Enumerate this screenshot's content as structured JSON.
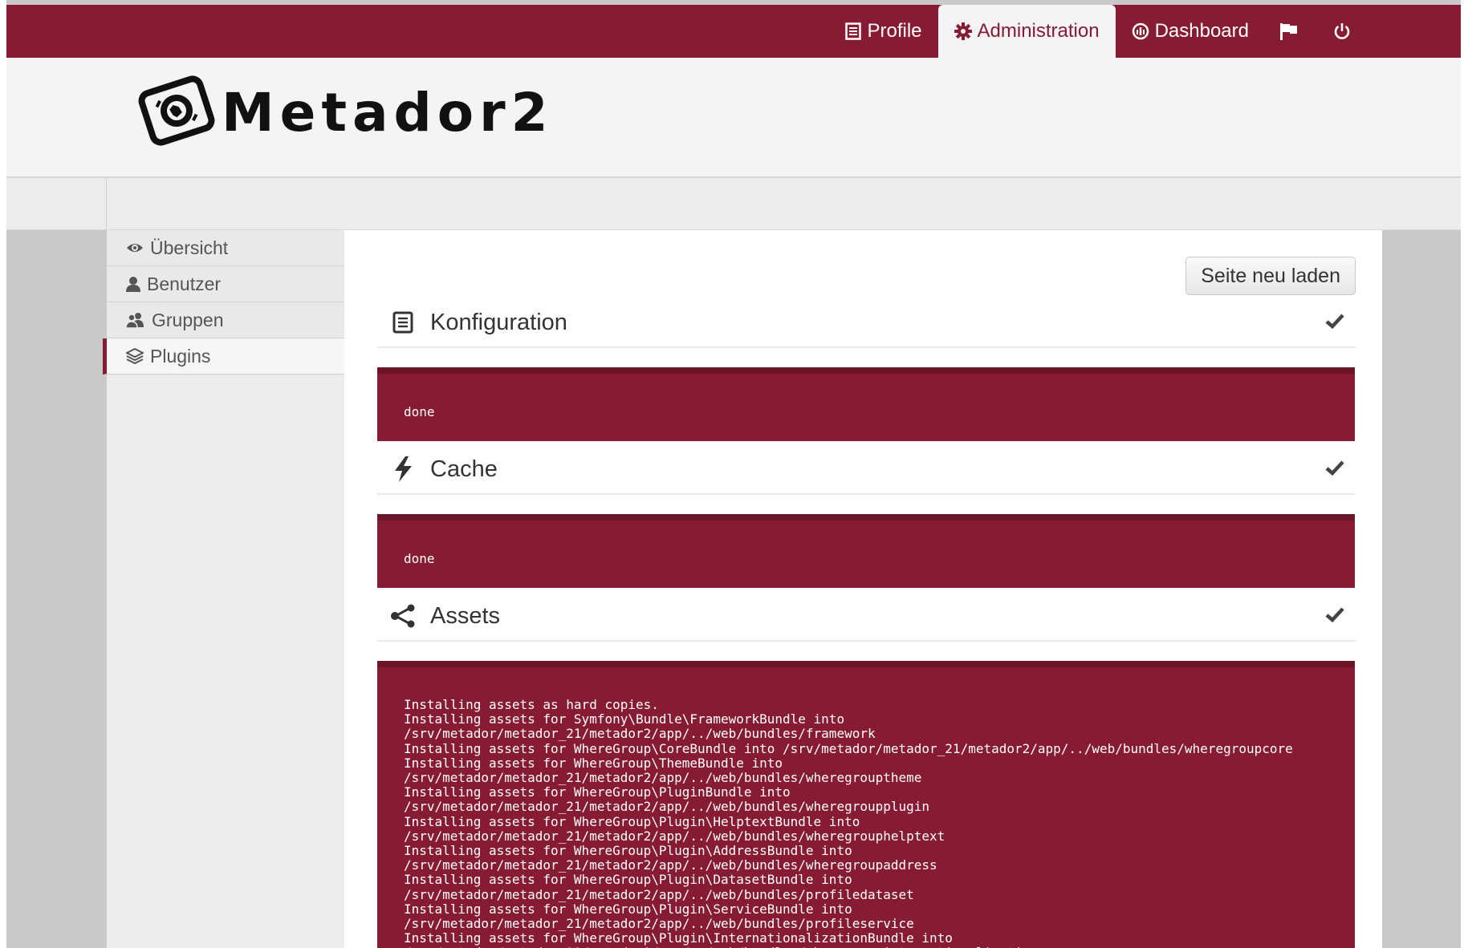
{
  "topnav": {
    "profile": "Profile",
    "administration": "Administration",
    "dashboard": "Dashboard",
    "flag_icon": "flag-icon",
    "power_icon": "power-icon"
  },
  "brand": {
    "name": "Metador2"
  },
  "sidebar": {
    "items": [
      {
        "label": "Übersicht",
        "icon": "eye-icon"
      },
      {
        "label": "Benutzer",
        "icon": "user-icon"
      },
      {
        "label": "Gruppen",
        "icon": "group-icon"
      },
      {
        "label": "Plugins",
        "icon": "layers-icon",
        "active": true
      }
    ]
  },
  "main": {
    "reload_label": "Seite neu laden",
    "sections": [
      {
        "title": "Konfiguration",
        "icon": "document-icon",
        "status": "check-icon",
        "output": "done"
      },
      {
        "title": "Cache",
        "icon": "bolt-icon",
        "status": "check-icon",
        "output": "done"
      },
      {
        "title": "Assets",
        "icon": "share-icon",
        "status": "check-icon",
        "output": "Installing assets as hard copies.\nInstalling assets for Symfony\\Bundle\\FrameworkBundle into\n/srv/metador/metador_21/metador2/app/../web/bundles/framework\nInstalling assets for WhereGroup\\CoreBundle into /srv/metador/metador_21/metador2/app/../web/bundles/wheregroupcore\nInstalling assets for WhereGroup\\ThemeBundle into\n/srv/metador/metador_21/metador2/app/../web/bundles/wheregrouptheme\nInstalling assets for WhereGroup\\PluginBundle into\n/srv/metador/metador_21/metador2/app/../web/bundles/wheregroupplugin\nInstalling assets for WhereGroup\\Plugin\\HelptextBundle into\n/srv/metador/metador_21/metador2/app/../web/bundles/wheregrouphelptext\nInstalling assets for WhereGroup\\Plugin\\AddressBundle into\n/srv/metador/metador_21/metador2/app/../web/bundles/wheregroupaddress\nInstalling assets for WhereGroup\\Plugin\\DatasetBundle into\n/srv/metador/metador_21/metador2/app/../web/bundles/profiledataset\nInstalling assets for WhereGroup\\Plugin\\ServiceBundle into\n/srv/metador/metador_21/metador2/app/../web/bundles/profileservice\nInstalling assets for WhereGroup\\Plugin\\InternationalizationBundle into\n/srv/metador/metador_21/metador2/app/../web/bundles/wheregroupinternationalization"
      }
    ]
  },
  "colors": {
    "brand": "#861b33",
    "brand_dark": "#6c1428"
  }
}
